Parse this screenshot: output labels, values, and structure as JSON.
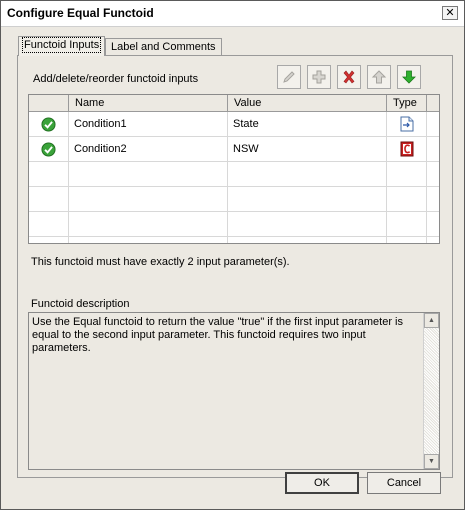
{
  "window": {
    "title": "Configure Equal Functoid",
    "close_glyph": "✕"
  },
  "tabs": [
    {
      "label": "Functoid Inputs",
      "active": true
    },
    {
      "label": "Label and Comments",
      "active": false
    }
  ],
  "inputs_section": {
    "caption": "Add/delete/reorder functoid inputs",
    "toolbar": [
      {
        "name": "edit-button",
        "icon": "pencil-icon",
        "enabled": false
      },
      {
        "name": "add-button",
        "icon": "plus-icon",
        "enabled": false
      },
      {
        "name": "delete-button",
        "icon": "red-x-icon",
        "enabled": true
      },
      {
        "name": "move-up-button",
        "icon": "up-arrow-icon",
        "enabled": false
      },
      {
        "name": "move-down-button",
        "icon": "green-down-arrow-icon",
        "enabled": true
      }
    ],
    "columns": [
      "Name",
      "Value",
      "Type"
    ],
    "rows": [
      {
        "status": "valid-check-icon",
        "name": "Condition1",
        "value": "State",
        "type_icon": "link-document-icon"
      },
      {
        "status": "valid-check-icon",
        "name": "Condition2",
        "value": "NSW",
        "type_icon": "constant-icon"
      }
    ],
    "empty_rows": 4
  },
  "rule_text": "This functoid must have exactly 2 input parameter(s).",
  "description": {
    "caption": "Functoid description",
    "text": "Use the Equal functoid to return the value \"true\" if the first input parameter is equal to the second input parameter. This functoid requires two input parameters."
  },
  "buttons": {
    "ok": "OK",
    "cancel": "Cancel"
  },
  "colors": {
    "check_green": "#3aa33a",
    "delete_red": "#d03030",
    "arrow_green": "#2fb02f",
    "constant_red": "#c82020"
  }
}
